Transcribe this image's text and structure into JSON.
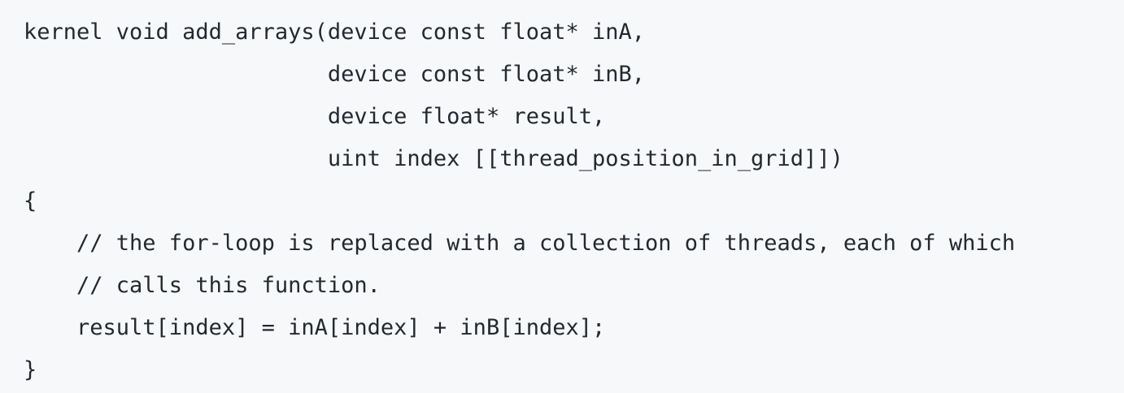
{
  "code": {
    "language": "metal",
    "lines": [
      "kernel void add_arrays(device const float* inA,",
      "                       device const float* inB,",
      "                       device float* result,",
      "                       uint index [[thread_position_in_grid]])",
      "{",
      "    // the for-loop is replaced with a collection of threads, each of which",
      "    // calls this function.",
      "    result[index] = inA[index] + inB[index];",
      "}"
    ]
  },
  "colors": {
    "background": "#f6f8fa",
    "text": "#24292f"
  }
}
